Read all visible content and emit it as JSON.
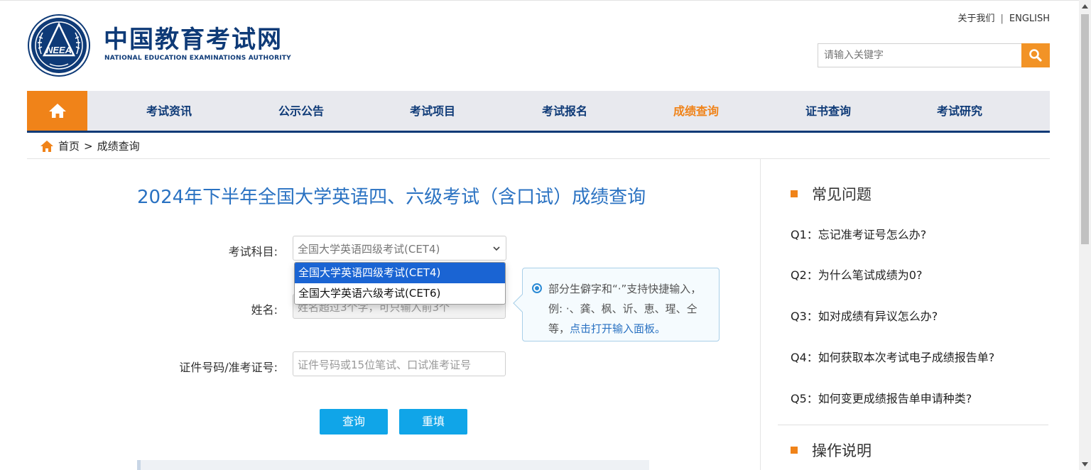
{
  "header": {
    "brand_cn": "中国教育考试网",
    "brand_en": "NATIONAL EDUCATION EXAMINATIONS AUTHORITY",
    "logo_text": "NEEA",
    "top_links": {
      "about": "关于我们",
      "separator": "|",
      "english": "ENGLISH"
    },
    "search": {
      "placeholder": "请输入关键字"
    }
  },
  "nav": {
    "items": [
      "考试资讯",
      "公示公告",
      "考试项目",
      "考试报名",
      "成绩查询",
      "证书查询",
      "考试研究"
    ],
    "active": "成绩查询"
  },
  "breadcrumb": {
    "home": "首页",
    "separator": ">",
    "current": "成绩查询"
  },
  "main": {
    "title": "2024年下半年全国大学英语四、六级考试（含口试）成绩查询",
    "form": {
      "subject_label": "考试科目:",
      "subject_value": "全国大学英语四级考试(CET4)",
      "subject_options": [
        "全国大学英语四级考试(CET4)",
        "全国大学英语六级考试(CET6)"
      ],
      "name_label": "姓名:",
      "name_placeholder": "姓名超过3个字，可只输入前3个",
      "id_label": "证件号码/准考证号:",
      "id_placeholder": "证件号码或15位笔试、口试准考证号"
    },
    "tip": {
      "text": "部分生僻字和“·”支持快捷输入，例: ·、龚、枫、䜣、恵、瑆、仝等，",
      "link": "点击打开输入面板。"
    },
    "buttons": {
      "query": "查询",
      "reset": "重填"
    }
  },
  "sidebar": {
    "faq_title": "常见问题",
    "faqs": [
      "Q1：忘记准考证号怎么办?",
      "Q2：为什么笔试成绩为0?",
      "Q3：如对成绩有异议怎么办?",
      "Q4：如何获取本次考试电子成绩报告单?",
      "Q5：如何变更成绩报告单申请种类?"
    ],
    "instructions_title": "操作说明"
  },
  "colors": {
    "brand_blue": "#0e3a77",
    "accent_orange": "#f08319",
    "title_blue": "#2a72c2",
    "button_blue": "#10a5e8"
  }
}
